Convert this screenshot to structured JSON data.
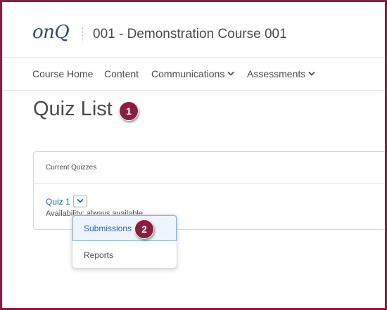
{
  "header": {
    "logo_text": "onQ",
    "course_title": "001 - Demonstration Course 001"
  },
  "nav": {
    "items": [
      {
        "label": "Course Home",
        "has_dropdown": false
      },
      {
        "label": "Content",
        "has_dropdown": false
      },
      {
        "label": "Communications",
        "has_dropdown": true
      },
      {
        "label": "Assessments",
        "has_dropdown": true
      }
    ]
  },
  "page": {
    "title": "Quiz List",
    "step_badge_1": "1",
    "step_badge_2": "2"
  },
  "panel": {
    "header": "Current Quizzes",
    "quiz_name": "Quiz 1",
    "availability": "Availability: always available"
  },
  "context_menu": {
    "items": [
      {
        "label": "Submissions",
        "state": "highlighted"
      },
      {
        "label": "Reports",
        "state": "normal"
      }
    ]
  },
  "colors": {
    "frame_border": "#8b1d3f",
    "badge": "#8b1d3f",
    "link": "#2767b0",
    "text": "#494c4e"
  }
}
